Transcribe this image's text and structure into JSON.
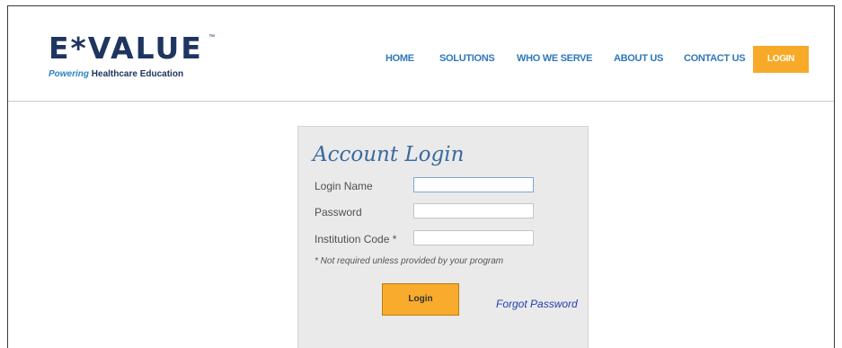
{
  "brand": {
    "logo_text": "E*VALUE",
    "trademark": "™",
    "tagline_a": "Powering",
    "tagline_b": "Healthcare Education"
  },
  "nav": {
    "items": [
      "HOME",
      "SOLUTIONS",
      "WHO WE SERVE",
      "ABOUT US",
      "CONTACT US"
    ],
    "login": "LOGIN"
  },
  "login": {
    "title": "Account Login",
    "login_name_label": "Login Name",
    "login_name_value": "",
    "password_label": "Password",
    "password_value": "",
    "institution_label": "Institution Code *",
    "institution_value": "",
    "note": "* Not required unless provided by your program",
    "submit_label": "Login",
    "forgot_label": "Forgot Password"
  },
  "colors": {
    "accent_orange": "#f7a928",
    "nav_blue": "#2f78ba",
    "brand_navy": "#1e3560",
    "link_blue": "#1f3fb0"
  }
}
